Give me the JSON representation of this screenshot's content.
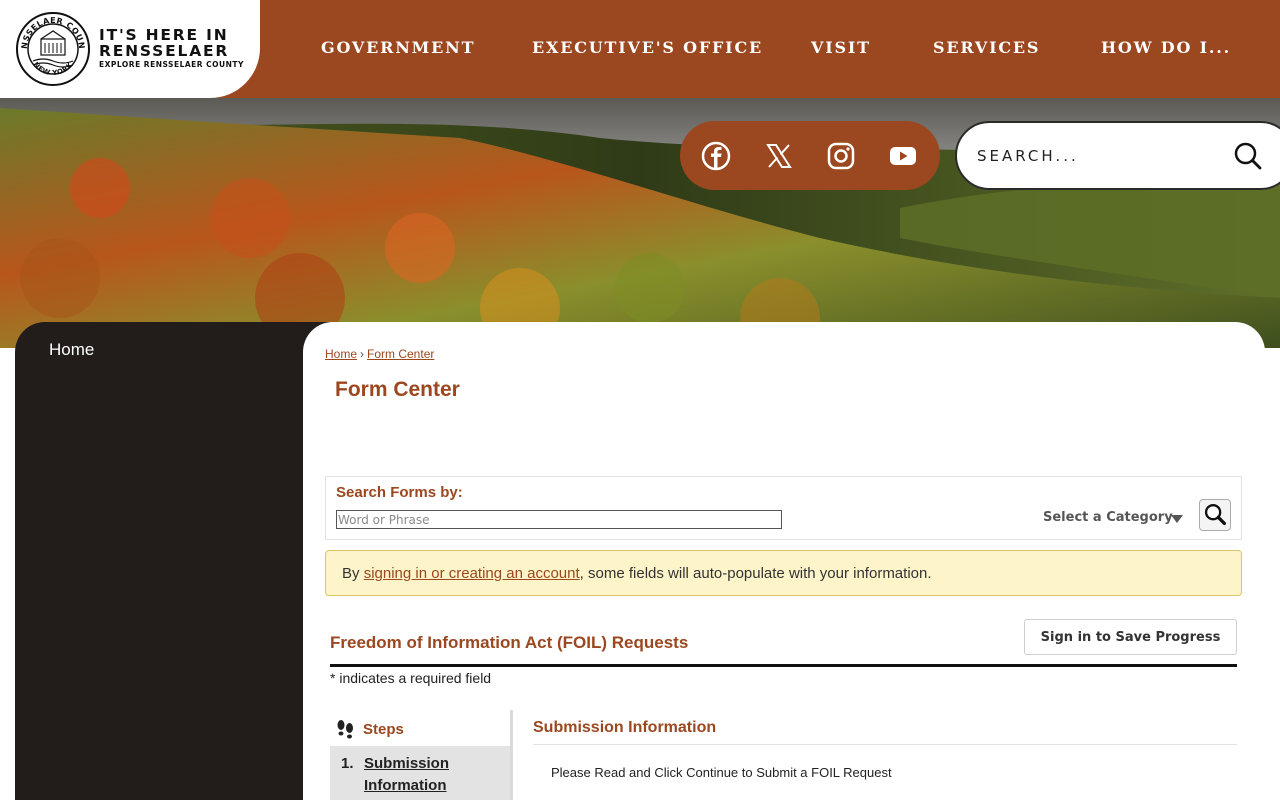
{
  "header": {
    "logo": {
      "seal_text_top": "RENSSELAER COUNTY",
      "seal_text_bottom": "NEW YORK",
      "line1": "IT'S HERE IN",
      "line2": "RENSSELAER",
      "line3": "EXPLORE RENSSELAER COUNTY"
    },
    "nav": [
      "GOVERNMENT",
      "EXECUTIVE'S OFFICE",
      "VISIT",
      "SERVICES",
      "HOW DO I..."
    ]
  },
  "social": {
    "icons": [
      "facebook-icon",
      "x-icon",
      "instagram-icon",
      "youtube-icon"
    ]
  },
  "search": {
    "placeholder": "SEARCH..."
  },
  "sidebar": {
    "home": "Home"
  },
  "breadcrumb": {
    "home": "Home",
    "separator": "›",
    "current": "Form Center"
  },
  "page_title": "Form Center",
  "search_forms": {
    "label": "Search Forms by:",
    "placeholder": "Word or Phrase",
    "category": "Select a Category"
  },
  "notice": {
    "prefix": "By ",
    "link": "signing in or creating an account",
    "suffix": ", some fields will auto-populate with your information."
  },
  "form": {
    "title": "Freedom of Information Act (FOIL) Requests",
    "save_button": "Sign in to Save Progress",
    "required_note": "* indicates a required field",
    "steps_label": "Steps",
    "steps": [
      {
        "number": "1.",
        "label": "Submission Information"
      }
    ],
    "section_title": "Submission Information",
    "section_body": "Please Read and Click Continue to Submit a FOIL Request"
  },
  "colors": {
    "brand": "#9b471f",
    "sidebar": "#221d1b",
    "notice_bg": "#fdf5c9"
  }
}
